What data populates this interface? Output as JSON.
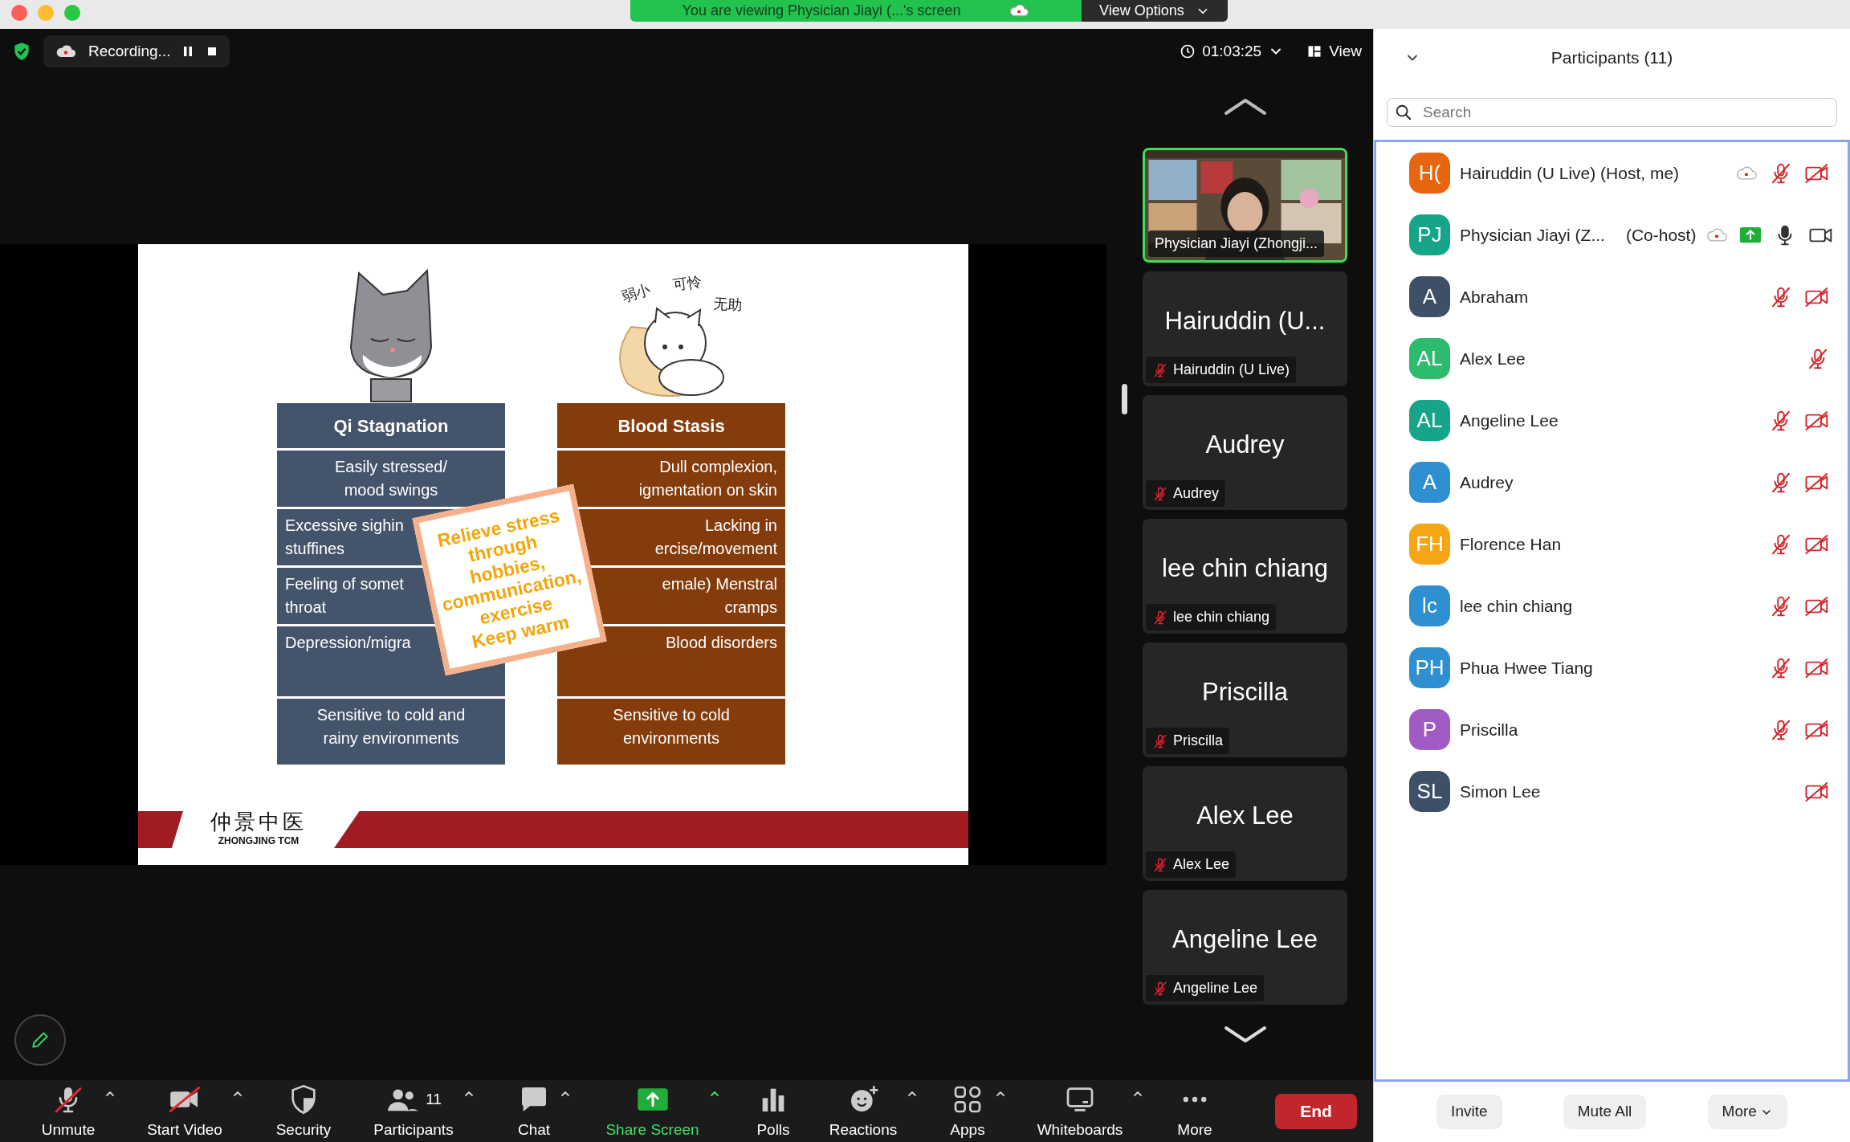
{
  "share_banner": {
    "text": "You are viewing Physician Jiayi (...'s screen",
    "button": "View Options"
  },
  "meeting_bar": {
    "recording": "Recording...",
    "timer": "01:03:25",
    "view": "View"
  },
  "slide": {
    "captions": [
      "弱小",
      "可怜",
      "无助"
    ],
    "columns": [
      {
        "title": "Qi Stagnation",
        "color": "#44546a",
        "cells": [
          {
            "text": "Easily stressed/\nmood swings",
            "partial": false
          },
          {
            "text": "Excessive sighin\nstuffines",
            "partial": true
          },
          {
            "text": "Feeling of somet\nthroat",
            "partial": true
          },
          {
            "text": "Depression/migra",
            "partial": true
          },
          {
            "text": "Sensitive to cold and\nrainy environments",
            "partial": false
          }
        ]
      },
      {
        "title": "Blood Stasis",
        "color": "#843c0c",
        "cells": [
          {
            "text": "Dull complexion,\nigmentation on skin",
            "partial": true
          },
          {
            "text": "Lacking in\nercise/movement",
            "partial": true
          },
          {
            "text": "emale) Menstral\ncramps",
            "partial": true
          },
          {
            "text": "Blood disorders",
            "partial": true
          },
          {
            "text": "Sensitive to cold\nenvironments",
            "partial": false
          }
        ]
      }
    ],
    "note": {
      "lines": [
        "Relieve stress",
        "through",
        "hobbies,",
        "communication,",
        "exercise",
        "Keep warm"
      ]
    },
    "logo": {
      "chinese": "仲景中医",
      "english": "ZHONGJING TCM"
    }
  },
  "gallery": [
    {
      "kind": "video",
      "label": "Physician Jiayi (Zhongji...",
      "speaking": true
    },
    {
      "kind": "name",
      "title": "Hairuddin (U...",
      "label": "Hairuddin (U Live)",
      "muted": true,
      "speaking": false
    },
    {
      "kind": "name",
      "title": "Audrey",
      "label": "Audrey",
      "muted": true,
      "speaking": false
    },
    {
      "kind": "name",
      "title": "lee chin chiang",
      "label": "lee chin chiang",
      "muted": true,
      "speaking": false
    },
    {
      "kind": "name",
      "title": "Priscilla",
      "label": "Priscilla",
      "muted": true,
      "speaking": false
    },
    {
      "kind": "name",
      "title": "Alex Lee",
      "label": "Alex Lee",
      "muted": true,
      "speaking": false
    },
    {
      "kind": "name",
      "title": "Angeline Lee",
      "label": "Angeline Lee",
      "muted": true,
      "speaking": false
    }
  ],
  "toolbar": [
    {
      "label": "Unmute",
      "kind": "mute",
      "caret": true,
      "highlight": false
    },
    {
      "label": "Start Video",
      "kind": "video",
      "caret": true,
      "highlight": false
    },
    {
      "label": "Security",
      "kind": "security",
      "caret": false,
      "highlight": false
    },
    {
      "label": "Participants",
      "kind": "participants",
      "count": "11",
      "caret": true,
      "highlight": false
    },
    {
      "label": "Chat",
      "kind": "chat",
      "caret": true,
      "highlight": false
    },
    {
      "label": "Share Screen",
      "kind": "share",
      "caret": true,
      "highlight": true
    },
    {
      "label": "Polls",
      "kind": "polls",
      "caret": false,
      "highlight": false
    },
    {
      "label": "Reactions",
      "kind": "reactions",
      "caret": true,
      "highlight": false
    },
    {
      "label": "Apps",
      "kind": "apps",
      "caret": true,
      "highlight": false
    },
    {
      "label": "Whiteboards",
      "kind": "whiteboards",
      "caret": true,
      "highlight": false
    },
    {
      "label": "More",
      "kind": "more",
      "caret": false,
      "highlight": false
    }
  ],
  "end_button": "End",
  "participants_panel": {
    "title": "Participants (11)",
    "search": {
      "placeholder": "Search"
    },
    "items": [
      {
        "initials": "H(",
        "name": "Hairuddin (U Live) (Host, me)",
        "color": "#e8650f",
        "recording": true,
        "sharing": false,
        "muted": true,
        "video_off": true
      },
      {
        "initials": "PJ",
        "name": "Physician Jiayi (Z...",
        "role": "(Co-host)",
        "color": "#17a589",
        "recording": true,
        "sharing": true,
        "muted": false,
        "video_off": false
      },
      {
        "initials": "A",
        "name": "Abraham",
        "color": "#3d5068",
        "recording": false,
        "sharing": false,
        "muted": true,
        "video_off": true
      },
      {
        "initials": "AL",
        "name": "Alex Lee",
        "color": "#2dbb6e",
        "recording": false,
        "sharing": false,
        "muted": true
      },
      {
        "initials": "AL",
        "name": "Angeline Lee",
        "color": "#17a589",
        "recording": false,
        "sharing": false,
        "muted": true,
        "video_off": true
      },
      {
        "initials": "A",
        "name": "Audrey",
        "color": "#2f8fd0",
        "recording": false,
        "sharing": false,
        "muted": true,
        "video_off": true
      },
      {
        "initials": "FH",
        "name": "Florence Han",
        "color": "#f5a516",
        "recording": false,
        "sharing": false,
        "muted": true,
        "video_off": true
      },
      {
        "initials": "lc",
        "name": "lee chin chiang",
        "color": "#2f8fd0",
        "recording": false,
        "sharing": false,
        "muted": true,
        "video_off": true
      },
      {
        "initials": "PH",
        "name": "Phua Hwee Tiang",
        "color": "#2f8fd0",
        "recording": false,
        "sharing": false,
        "muted": true,
        "video_off": true
      },
      {
        "initials": "P",
        "name": "Priscilla",
        "color": "#a05cc4",
        "recording": false,
        "sharing": false,
        "muted": true,
        "video_off": true
      },
      {
        "initials": "SL",
        "name": "Simon Lee",
        "color": "#3d5068",
        "recording": false,
        "sharing": false,
        "video_off": true
      }
    ],
    "buttons": [
      {
        "label": "Invite",
        "kind": "plain"
      },
      {
        "label": "Mute All",
        "kind": "plain"
      },
      {
        "label": "More",
        "kind": "menu"
      }
    ]
  }
}
